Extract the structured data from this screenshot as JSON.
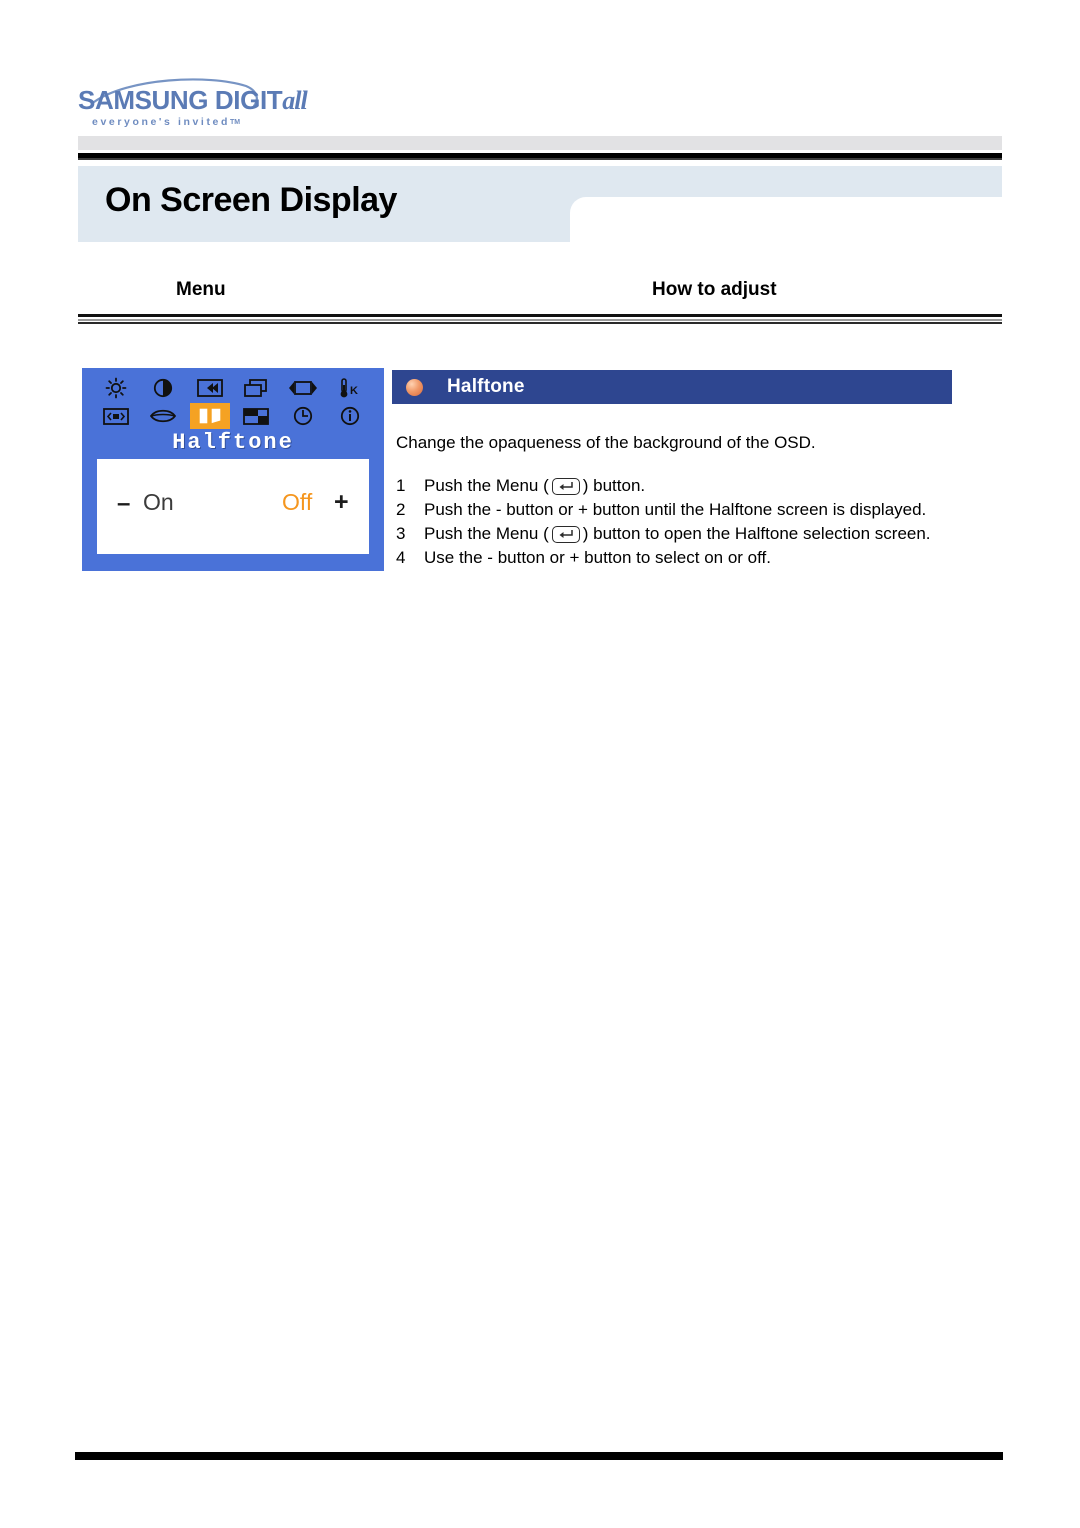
{
  "brand": {
    "wordmark_main": "SAMSUNG DIGIT",
    "wordmark_italic": "all",
    "tagline": "everyone's invited",
    "tagline_tm": "TM",
    "logo_color": "#5b7bb5"
  },
  "page": {
    "title": "On Screen Display",
    "title_band_color": "#dfe8f0"
  },
  "columns": {
    "menu_header": "Menu",
    "adjust_header": "How to adjust"
  },
  "osd": {
    "background_color": "#4a72d8",
    "menu_label": "Halftone",
    "minus_symbol": "–",
    "plus_symbol": "+",
    "option_on": "On",
    "option_off": "Off",
    "selected_option": "Off",
    "selected_option_color": "#f5961e",
    "highlight_color": "#f5a223",
    "icons_row1": [
      {
        "name": "brightness-icon"
      },
      {
        "name": "contrast-icon"
      },
      {
        "name": "image-lock-icon"
      },
      {
        "name": "image-size-icon"
      },
      {
        "name": "horizontal-position-icon"
      },
      {
        "name": "color-temperature-icon"
      }
    ],
    "icons_row2": [
      {
        "name": "pincushion-icon"
      },
      {
        "name": "language-icon"
      },
      {
        "name": "halftone-icon",
        "selected": true
      },
      {
        "name": "osd-position-icon"
      },
      {
        "name": "display-time-icon"
      },
      {
        "name": "information-icon"
      }
    ]
  },
  "section": {
    "title": "Halftone",
    "header_color": "#2e4690",
    "bullet": "orange-sphere-bullet",
    "intro": "Change the opaqueness of the background of the OSD.",
    "steps": [
      {
        "num": "1",
        "before": "Push the Menu (",
        "key": "menu-enter-key",
        "after": ") button."
      },
      {
        "num": "2",
        "before": "Push the - button or + button until the Halftone screen is displayed.",
        "key": null,
        "after": ""
      },
      {
        "num": "3",
        "before": "Push the Menu (",
        "key": "menu-enter-key",
        "after": ") button to open the Halftone selection screen."
      },
      {
        "num": "4",
        "before": "Use the - button or + button to select on or off.",
        "key": null,
        "after": ""
      }
    ]
  }
}
